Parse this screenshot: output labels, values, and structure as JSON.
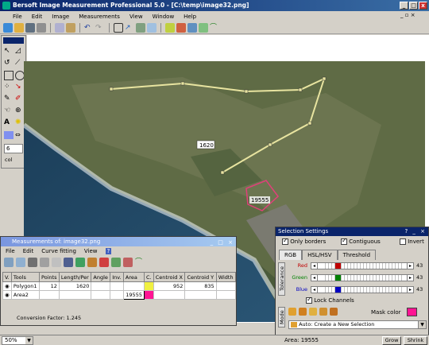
{
  "app": {
    "title": "Bersoft Image Measurement Professional 5.0 - [C:\\temp\\image32.png]"
  },
  "menu": [
    "File",
    "Edit",
    "Image",
    "Measurements",
    "View",
    "Window",
    "Help"
  ],
  "toolbar_icons": [
    "new-icon",
    "open-icon",
    "save-icon",
    "print-icon",
    "copy-icon",
    "paste-icon",
    "undo-icon",
    "redo-icon",
    "ruler-icon",
    "arrow-icon",
    "scan-icon",
    "grid-icon",
    "chart-icon",
    "curve-icon"
  ],
  "palette": {
    "spin_value": "6",
    "col_label": "col"
  },
  "image": {
    "label_1620": "1620",
    "label_19555": "19555"
  },
  "measurements": {
    "title": "Measurements of: image32.png",
    "menu": [
      "File",
      "Edit",
      "Curve fitting",
      "View",
      "?"
    ],
    "columns": [
      "V.",
      "Tools",
      "Points",
      "Length/Per",
      "Angle",
      "Inv.",
      "Area",
      "C.",
      "Centroid X",
      "Centroid Y",
      "Width"
    ],
    "rows": [
      {
        "tool": "Polygon1",
        "points": "12",
        "length": "1620",
        "angle": "",
        "inv": "",
        "area": "",
        "centroid_x": "952",
        "centroid_y": "835",
        "width": ""
      },
      {
        "tool": "Area2",
        "points": "",
        "length": "",
        "angle": "",
        "inv": "",
        "area": "19555",
        "centroid_x": "",
        "centroid_y": "",
        "width": ""
      }
    ],
    "conversion_factor": "Conversion Factor: 1.245"
  },
  "selection": {
    "title": "Selection Settings",
    "only_borders": "Only borders",
    "contiguous": "Contiguous",
    "invert": "Invert",
    "tabs": [
      "RGB",
      "HSL/HSV",
      "Threshold"
    ],
    "tolerance_label": "Tolerance",
    "channels": [
      {
        "name": "Red",
        "value": "43",
        "color": "#c00000"
      },
      {
        "name": "Green",
        "value": "43",
        "color": "#008000"
      },
      {
        "name": "Blue",
        "value": "43",
        "color": "#0000c0"
      }
    ],
    "lock_channels": "Lock Channels",
    "mode_label": "Mode",
    "mask_color_label": "Mask color",
    "mask_color": "#ff1493",
    "mode_option": "Auto: Create a New Selection",
    "area_text": "Area: 19555",
    "grow": "Grow",
    "shrink": "Shrink"
  },
  "status": {
    "zoom": "50%"
  }
}
